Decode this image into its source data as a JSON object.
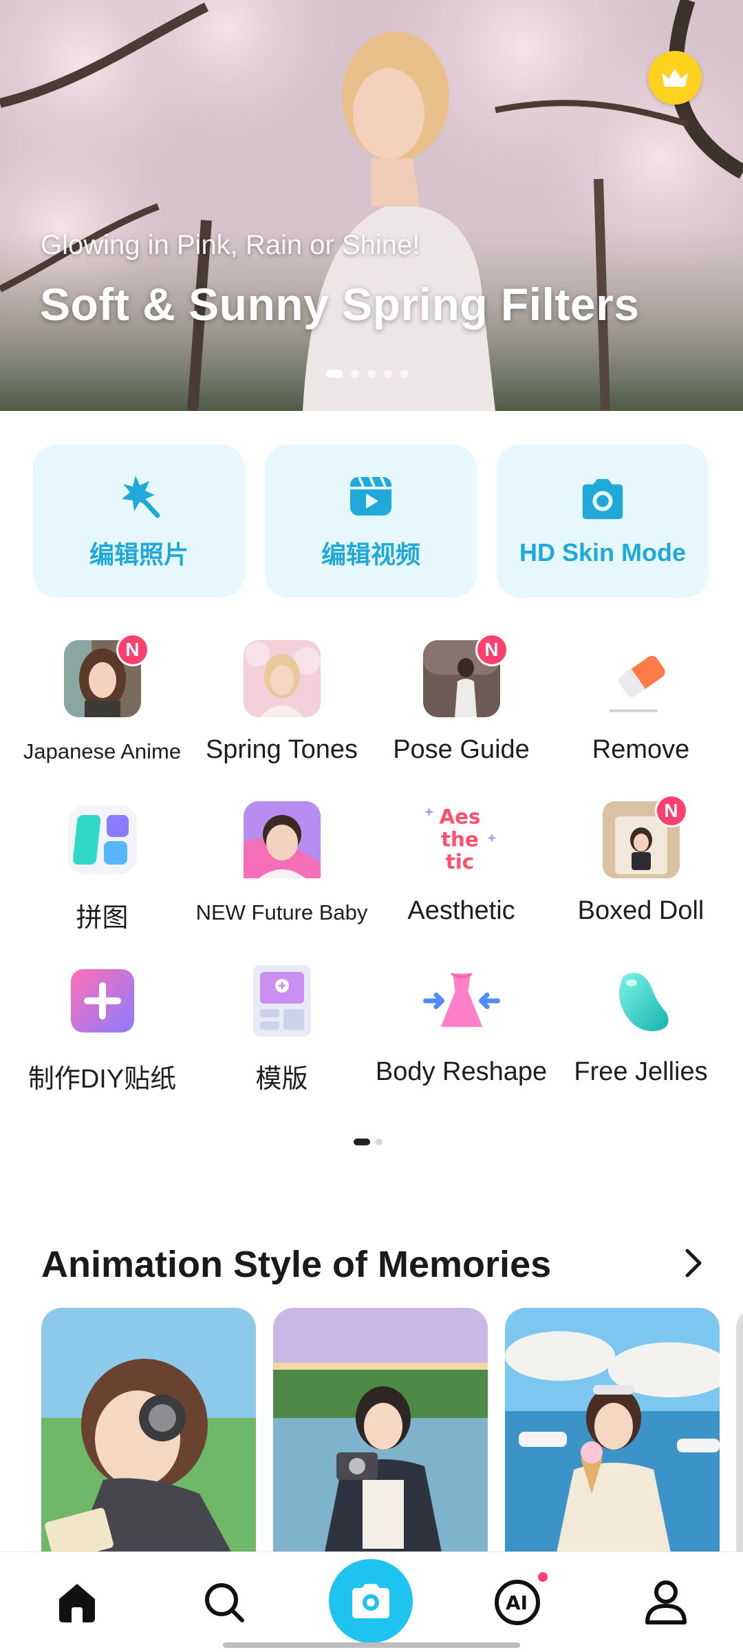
{
  "hero": {
    "subtitle": "Glowing in Pink, Rain or Shine!",
    "title": "Soft & Sunny Spring Filters",
    "slide_count": 5,
    "active_slide": 1,
    "premium_icon": "crown-icon"
  },
  "quick_actions": [
    {
      "label": "编辑照片",
      "icon": "magic-wand-icon"
    },
    {
      "label": "编辑视频",
      "icon": "video-clapper-icon"
    },
    {
      "label": "HD Skin Mode",
      "icon": "camera-icon"
    }
  ],
  "tools": [
    {
      "label": "Japanese Anime",
      "icon": "anime-girl-thumbnail",
      "badge": "N"
    },
    {
      "label": "Spring Tones",
      "icon": "spring-portrait-thumbnail",
      "badge": ""
    },
    {
      "label": "Pose Guide",
      "icon": "pose-thumbnail",
      "badge": "N"
    },
    {
      "label": "Remove",
      "icon": "eraser-icon",
      "badge": ""
    },
    {
      "label": "拼图",
      "icon": "collage-icon",
      "badge": ""
    },
    {
      "label": "NEW Future Baby",
      "icon": "baby-thumbnail",
      "badge": ""
    },
    {
      "label": "Aesthetic",
      "icon": "aesthetic-text-icon",
      "badge": "",
      "icon_text": "Aes the tic"
    },
    {
      "label": "Boxed Doll",
      "icon": "boxed-doll-thumbnail",
      "badge": "N"
    },
    {
      "label": "制作DIY贴纸",
      "icon": "plus-sticker-icon",
      "badge": ""
    },
    {
      "label": "模版",
      "icon": "template-icon",
      "badge": ""
    },
    {
      "label": "Body Reshape",
      "icon": "dress-reshape-icon",
      "badge": ""
    },
    {
      "label": "Free Jellies",
      "icon": "jelly-bean-icon",
      "badge": ""
    }
  ],
  "tool_pages": {
    "count": 2,
    "active": 1
  },
  "section": {
    "title": "Animation Style of Memories",
    "more_icon": "chevron-right-icon",
    "cards": [
      "headphones-girl-card",
      "camera-girl-card",
      "ice-cream-girl-card"
    ]
  },
  "bottom_nav": [
    {
      "name": "home",
      "icon": "home-icon",
      "active": true
    },
    {
      "name": "search",
      "icon": "search-icon",
      "active": false
    },
    {
      "name": "camera",
      "icon": "camera-icon",
      "active": false
    },
    {
      "name": "ai",
      "icon": "ai-icon",
      "active": false,
      "dot": true
    },
    {
      "name": "profile",
      "icon": "profile-icon",
      "active": false
    }
  ],
  "colors": {
    "accent": "#1fa8d8",
    "quick_bg": "#e6f8fd",
    "badge": "#ff3f6e",
    "crown": "#ffd21f",
    "camera_btn": "#1ec3ef"
  }
}
